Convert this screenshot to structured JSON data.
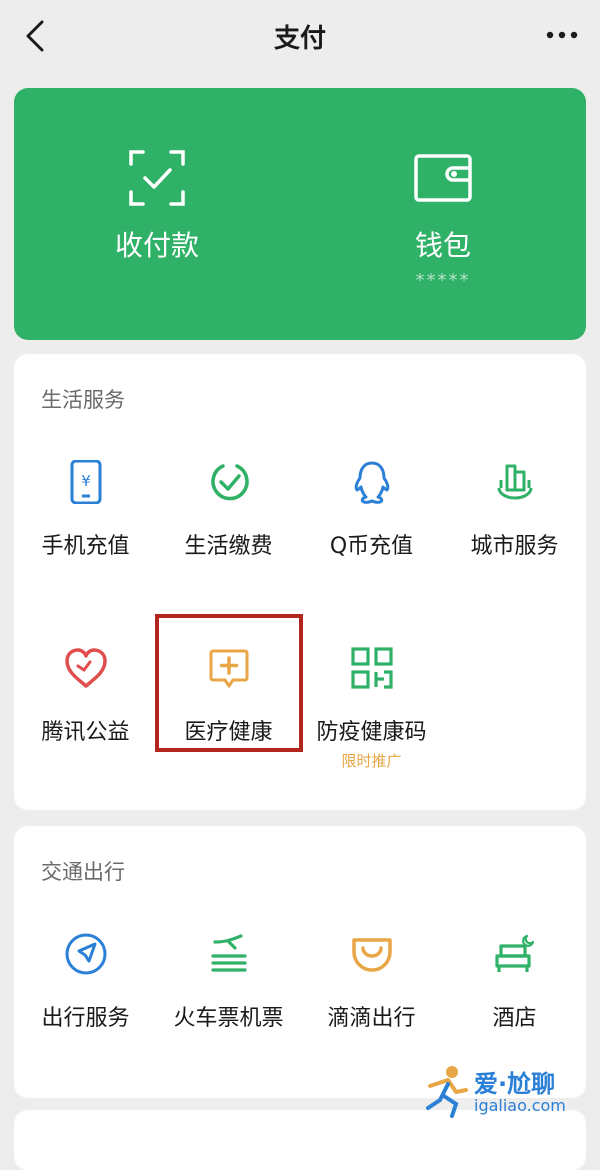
{
  "nav": {
    "title": "支付"
  },
  "hero": {
    "pay_label": "收付款",
    "wallet_label": "钱包",
    "wallet_balance": "*****"
  },
  "life": {
    "title": "生活服务",
    "items": [
      {
        "label": "手机充值",
        "icon": "phone-recharge-icon"
      },
      {
        "label": "生活缴费",
        "icon": "life-payment-icon"
      },
      {
        "label": "Q币充值",
        "icon": "qq-coin-icon"
      },
      {
        "label": "城市服务",
        "icon": "city-service-icon"
      },
      {
        "label": "腾讯公益",
        "icon": "charity-heart-icon"
      },
      {
        "label": "医疗健康",
        "icon": "medical-health-icon"
      },
      {
        "label": "防疫健康码",
        "icon": "health-code-icon",
        "tag": "限时推广"
      }
    ]
  },
  "transport": {
    "title": "交通出行",
    "items": [
      {
        "label": "出行服务",
        "icon": "travel-service-icon"
      },
      {
        "label": "火车票机票",
        "icon": "train-plane-icon"
      },
      {
        "label": "滴滴出行",
        "icon": "didi-icon"
      },
      {
        "label": "酒店",
        "icon": "hotel-icon"
      }
    ]
  },
  "watermark": {
    "top": "爱·尬聊",
    "bottom": "igaliao.com"
  },
  "colors": {
    "green": "#2fb167",
    "blue": "#2a7fd6",
    "orange": "#e8a646",
    "red": "#e04d4d",
    "highlight": "#b3261e"
  }
}
